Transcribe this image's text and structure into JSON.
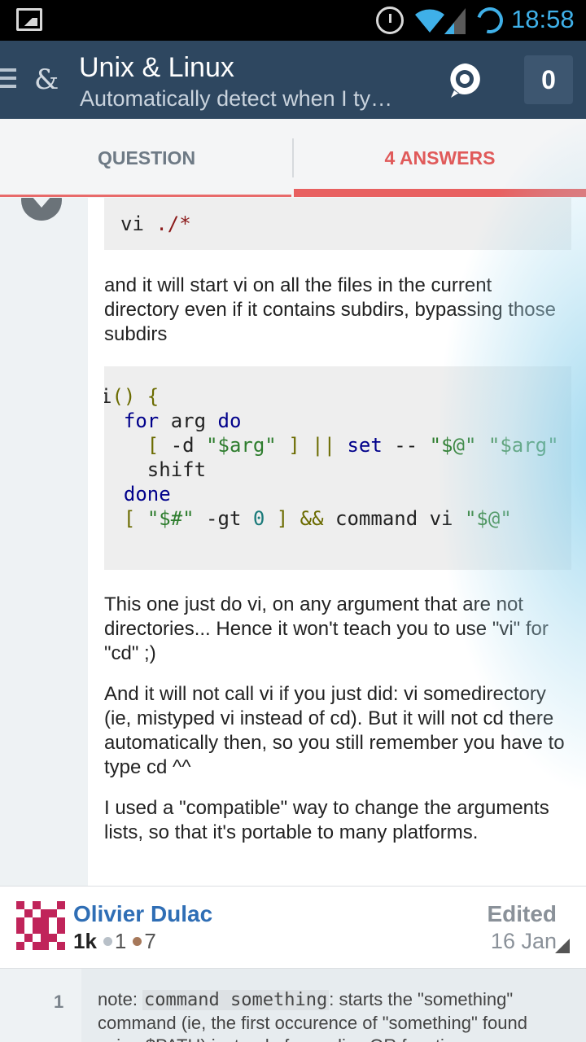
{
  "status_bar": {
    "time": "18:58",
    "icons": [
      "image-icon",
      "alarm-icon",
      "wifi-icon",
      "signal-icon",
      "battery-icon"
    ]
  },
  "app_bar": {
    "title": "Unix & Linux",
    "subtitle": "Automatically detect when I ty…",
    "inbox_count": "0",
    "site_icon_glyph": "&",
    "colors": {
      "background": "#2e4760",
      "accent": "#e86060"
    }
  },
  "tabs": [
    {
      "label": "QUESTION",
      "active": false
    },
    {
      "label": "4 ANSWERS",
      "active": true
    }
  ],
  "answer": {
    "code_block_1": {
      "cmd": "vi",
      "path": "./*"
    },
    "paragraph_1": "and it will start vi on all the files in the current directory even if it contains subdirs, bypassing those subdirs",
    "code_block_2": {
      "lines": [
        [
          {
            "t": "i",
            "c": ""
          },
          {
            "t": "() {",
            "c": "pun"
          }
        ],
        [
          {
            "t": "  ",
            "c": ""
          },
          {
            "t": "for",
            "c": "kw"
          },
          {
            "t": " arg ",
            "c": ""
          },
          {
            "t": "do",
            "c": "kw"
          }
        ],
        [
          {
            "t": "    ",
            "c": ""
          },
          {
            "t": "[ ",
            "c": "pun"
          },
          {
            "t": "-d ",
            "c": ""
          },
          {
            "t": "\"$arg\"",
            "c": "str"
          },
          {
            "t": " ] || ",
            "c": "pun"
          },
          {
            "t": "set",
            "c": "kw"
          },
          {
            "t": " -- ",
            "c": ""
          },
          {
            "t": "\"$@\"",
            "c": "str"
          },
          {
            "t": " ",
            "c": ""
          },
          {
            "t": "\"$arg\"",
            "c": "str"
          }
        ],
        [
          {
            "t": "    shift",
            "c": ""
          }
        ],
        [
          {
            "t": "  ",
            "c": ""
          },
          {
            "t": "done",
            "c": "kw"
          }
        ],
        [
          {
            "t": "  ",
            "c": ""
          },
          {
            "t": "[ ",
            "c": "pun"
          },
          {
            "t": "\"$#\"",
            "c": "str"
          },
          {
            "t": " -gt ",
            "c": ""
          },
          {
            "t": "0",
            "c": "num"
          },
          {
            "t": " ] && ",
            "c": "pun"
          },
          {
            "t": "command vi ",
            "c": ""
          },
          {
            "t": "\"$@\"",
            "c": "str"
          }
        ]
      ]
    },
    "paragraph_2": "This one just do vi, on any argument that are not directories... Hence it won't teach you to use \"vi\" for \"cd\" ;)",
    "paragraph_3": "And it will not call vi if you just did: vi somedirectory (ie, mistyped vi instead of cd). But it will not cd there automatically then, so you still remember you have to type cd ^^",
    "paragraph_4": "I used a \"compatible\" way to change the arguments lists, so that it's portable to many platforms."
  },
  "author": {
    "name": "Olivier Dulac",
    "reputation": "1k",
    "silver_badges": "1",
    "bronze_badges": "7",
    "edited_label": "Edited",
    "edited_date": "16 Jan"
  },
  "comments": [
    {
      "score": "1",
      "prefix": "note: ",
      "code": "command something",
      "text": ": starts the \"something\" command (ie, the first occurence of \"something\" found using $PATH) instead of any alias OR function"
    }
  ]
}
